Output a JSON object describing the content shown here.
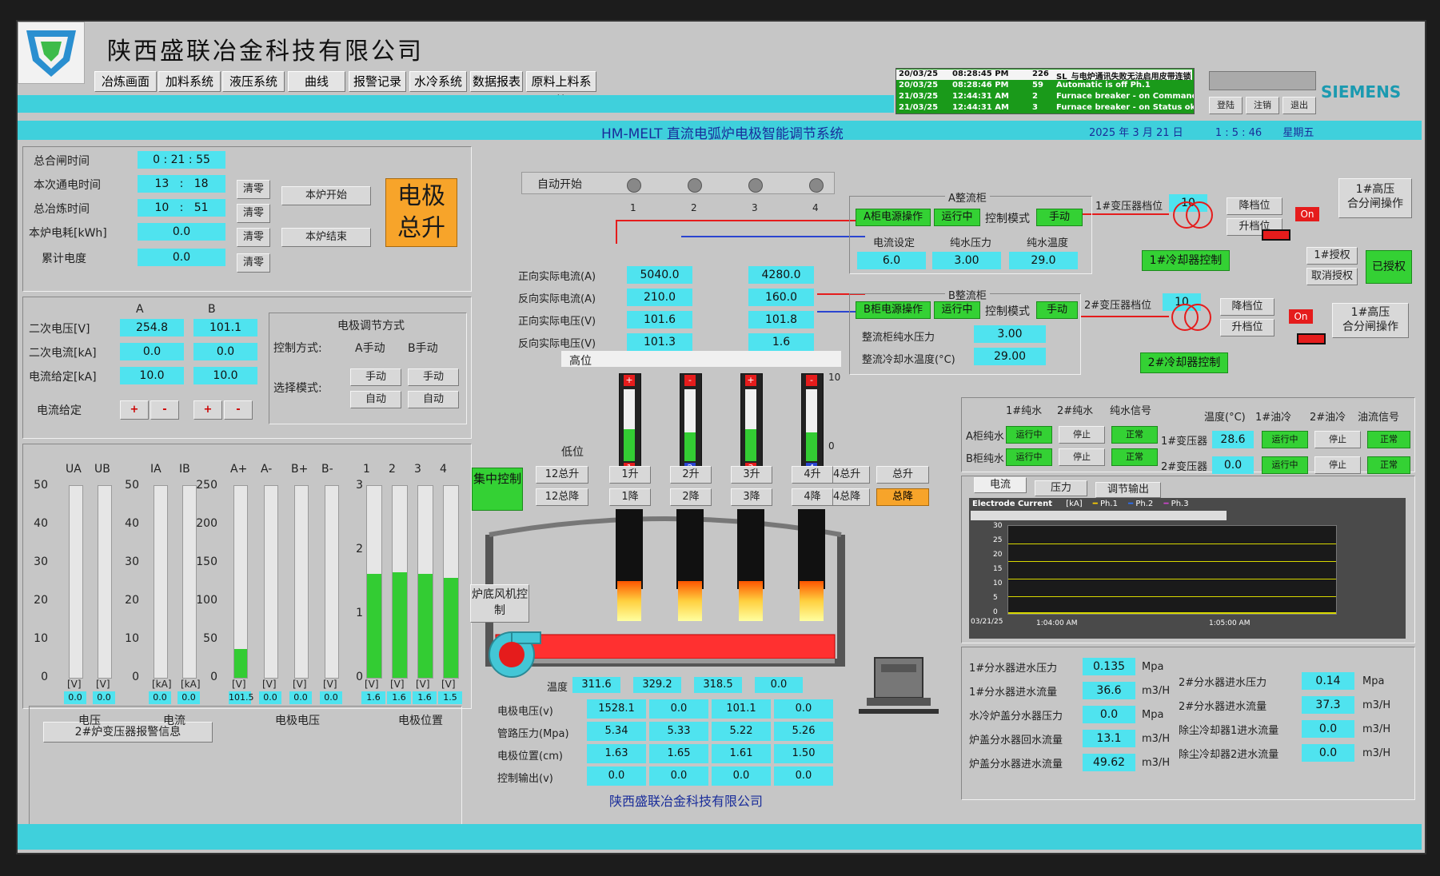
{
  "company": {
    "title": "陕西盛联冶金科技有限公司",
    "footer": "陕西盛联冶金科技有限公司"
  },
  "nav": [
    "冶炼画面",
    "加料系统",
    "液压系统",
    "曲线",
    "报警记录",
    "水冷系统",
    "数据报表",
    "原料上料系统"
  ],
  "system_title": "HM-MELT 直流电弧炉电极智能调节系统",
  "date": {
    "year": "2025",
    "year_unit": "年",
    "month": "3",
    "month_unit": "月",
    "day": "21",
    "day_unit": "日",
    "time": "1 : 5 : 46",
    "weekday": "星期五"
  },
  "brand": "SIEMENS",
  "login_buttons": [
    "登陆",
    "注销",
    "退出"
  ],
  "alarms": [
    {
      "date": "20/03/25",
      "time": "08:28:45 PM",
      "code": "226",
      "msg": "SL_与电炉通讯失败无法启用皮带连锁",
      "color": "#222"
    },
    {
      "date": "20/03/25",
      "time": "08:28:46 PM",
      "code": "59",
      "msg": "Automatic is off Ph.1",
      "color": "#1a9a1a"
    },
    {
      "date": "21/03/25",
      "time": "12:44:31 AM",
      "code": "2",
      "msg": "Furnace breaker - on Command",
      "color": "#1a9a1a"
    },
    {
      "date": "21/03/25",
      "time": "12:44:31 AM",
      "code": "3",
      "msg": "Furnace breaker - on Status ok",
      "color": "#1a9a1a"
    }
  ],
  "timers": {
    "total_close_label": "总合闸时间",
    "total_close_value": "0 : 21 : 55",
    "power_on_label": "本次通电时间",
    "power_on_h": "13",
    "power_on_sep": ":",
    "power_on_m": "18",
    "smelt_label": "总冶炼时间",
    "smelt_h": "10",
    "smelt_sep": ":",
    "smelt_m": "51",
    "energy_label": "本炉电耗[kWh]",
    "energy_value": "0.0",
    "cumulative_label": "累计电度",
    "cumulative_value": "0.0",
    "clear_label": "清零",
    "start_label": "本炉开始",
    "end_label": "本炉结束",
    "raise_all": "电极总升"
  },
  "ab_params": {
    "col_a": "A",
    "col_b": "B",
    "rows": [
      {
        "label": "二次电压[V]",
        "a": "254.8",
        "b": "101.1"
      },
      {
        "label": "二次电流[kA]",
        "a": "0.0",
        "b": "0.0"
      },
      {
        "label": "电流给定[kA]",
        "a": "10.0",
        "b": "10.0"
      }
    ],
    "setpoint_label": "电流给定",
    "plus": "+",
    "minus": "-"
  },
  "regulation": {
    "title": "电极调节方式",
    "control_label": "控制方式:",
    "a_manual": "A手动",
    "b_manual": "B手动",
    "select_label": "选择模式:",
    "manual": "手动",
    "auto": "自动"
  },
  "bars": {
    "volt": {
      "cols": [
        "UA",
        "UB"
      ],
      "ticks": [
        "50",
        "40",
        "30",
        "20",
        "10",
        "0"
      ],
      "values": [
        "0.0",
        "0.0"
      ],
      "fill": [
        0,
        0
      ],
      "unit": "[V]",
      "caption": "电压"
    },
    "curr": {
      "cols": [
        "IA",
        "IB"
      ],
      "ticks": [
        "50",
        "40",
        "30",
        "20",
        "10",
        "0"
      ],
      "values": [
        "0.0",
        "0.0"
      ],
      "fill": [
        0,
        0
      ],
      "unit": "[kA]",
      "caption": "电流"
    },
    "evolt": {
      "cols": [
        "A+",
        "A-",
        "B+",
        "B-"
      ],
      "ticks": [
        "250",
        "200",
        "150",
        "100",
        "50",
        "0"
      ],
      "values": [
        "101.5",
        "0.0",
        "0.0",
        "0.0"
      ],
      "fill": [
        0.15,
        0,
        0,
        0
      ],
      "unit": "[V]",
      "caption": "电极电压"
    },
    "epos": {
      "cols": [
        "1",
        "2",
        "3",
        "4"
      ],
      "ticks": [
        "3",
        "2",
        "1",
        "0"
      ],
      "values": [
        "1.6",
        "1.6",
        "1.6",
        "1.5"
      ],
      "fill": [
        0.54,
        0.55,
        0.54,
        0.52
      ],
      "unit": "[V]",
      "caption": "电极位置"
    }
  },
  "alarm_info_label": "2#炉变压器报警信息",
  "auto_start": {
    "label": "自动开始",
    "numbers": [
      "1",
      "2",
      "3",
      "4"
    ]
  },
  "currents": {
    "labels": [
      "正向实际电流(A)",
      "反向实际电流(A)",
      "正向实际电压(V)",
      "反向实际电压(V)"
    ],
    "col1": [
      "5040.0",
      "210.0",
      "101.6",
      "101.3"
    ],
    "col2": [
      "4280.0",
      "160.0",
      "101.8",
      "1.6"
    ]
  },
  "electrodes": {
    "high_label": "高位",
    "low_label": "低位",
    "scale_top": "10",
    "scale_bottom": "0",
    "labels_top": [
      "+",
      "-",
      "+",
      "-"
    ],
    "labels_bottom": [
      "1",
      "2",
      "3",
      "4"
    ],
    "levels": [
      0.45,
      0.4,
      0.45,
      0.4
    ],
    "central_control": "集中控制",
    "up": [
      "1升",
      "2升",
      "3升",
      "4升"
    ],
    "down": [
      "1降",
      "2降",
      "3降",
      "4降"
    ],
    "group_up_12": "12总升",
    "group_down_12": "12总降",
    "group_up_34": "34总升",
    "group_down_34": "34总降",
    "total_up": "总升",
    "total_down": "总降"
  },
  "fan_label": "炉底风机控制",
  "temperature": {
    "label": "温度",
    "values": [
      "311.6",
      "329.2",
      "318.5",
      "0.0"
    ]
  },
  "bottom_table": {
    "labels": [
      "电极电压(v)",
      "管路压力(Mpa)",
      "电极位置(cm)",
      "控制输出(v)"
    ],
    "rows": [
      [
        "1528.1",
        "0.0",
        "101.1",
        "0.0"
      ],
      [
        "5.34",
        "5.33",
        "5.22",
        "5.26"
      ],
      [
        "1.63",
        "1.65",
        "1.61",
        "1.50"
      ],
      [
        "0.0",
        "0.0",
        "0.0",
        "0.0"
      ]
    ]
  },
  "rect_a": {
    "title": "A整流柜",
    "power_op": "A柜电源操作",
    "running": "运行中",
    "mode_label": "控制模式",
    "mode": "手动",
    "headers": [
      "电流设定",
      "纯水压力",
      "纯水温度"
    ],
    "values": [
      "6.0",
      "3.00",
      "29.0"
    ]
  },
  "rect_b": {
    "title": "B整流柜",
    "power_op": "B柜电源操作",
    "running": "运行中",
    "mode_label": "控制模式",
    "mode": "手动",
    "rows": [
      {
        "label": "整流柜纯水压力",
        "value": "3.00"
      },
      {
        "label": "整流冷却水温度(°C)",
        "value": "29.00"
      }
    ]
  },
  "transformer": {
    "t1_label": "1#变压器档位",
    "t1_value": "10",
    "t2_label": "2#变压器档位",
    "t2_value": "10",
    "down": "降档位",
    "up": "升档位",
    "on": "On",
    "hv1": "1#高压\n合分闸操作",
    "hv2": "1#高压\n合分闸操作",
    "cool1": "1#冷却器控制",
    "cool2": "2#冷却器控制",
    "auth": "1#授权",
    "revoke": "取消授权",
    "authorized": "已授权"
  },
  "water": {
    "h1": "1#纯水",
    "h2": "2#纯水",
    "h3": "纯水信号",
    "rows": [
      {
        "label": "A柜纯水",
        "s1": "运行中",
        "s2": "停止",
        "s3": "正常"
      },
      {
        "label": "B柜纯水",
        "s1": "运行中",
        "s2": "停止",
        "s3": "正常"
      }
    ],
    "temp_h": "温度(°C)",
    "oil1_h": "1#油冷",
    "oil2_h": "2#油冷",
    "flow_h": "油流信号",
    "trows": [
      {
        "label": "1#变压器",
        "t": "28.6",
        "o1": "运行中",
        "o2": "停止",
        "f": "正常"
      },
      {
        "label": "2#变压器",
        "t": "0.0",
        "o1": "运行中",
        "o2": "停止",
        "f": "正常"
      }
    ]
  },
  "trend": {
    "tabs": [
      "电流",
      "压力",
      "调节输出"
    ],
    "title": "Electrode Current",
    "unit": "[kA]",
    "legend": [
      "Ph.1",
      "Ph.2",
      "Ph.3"
    ],
    "yticks": [
      "30",
      "25",
      "20",
      "15",
      "10",
      "5",
      "0"
    ],
    "date": "03/21/25",
    "t1": "1:04:00 AM",
    "t2": "1:05:00 AM"
  },
  "distributors": {
    "left": [
      {
        "label": "1#分水器进水压力",
        "value": "0.135",
        "unit": "Mpa"
      },
      {
        "label": "1#分水器进水流量",
        "value": "36.6",
        "unit": "m3/H"
      },
      {
        "label": "水冷炉盖分水器压力",
        "value": "0.0",
        "unit": "Mpa"
      },
      {
        "label": "炉盖分水器回水流量",
        "value": "13.1",
        "unit": "m3/H"
      },
      {
        "label": "炉盖分水器进水流量",
        "value": "49.62",
        "unit": "m3/H"
      }
    ],
    "right": [
      {
        "label": "2#分水器进水压力",
        "value": "0.14",
        "unit": "Mpa"
      },
      {
        "label": "2#分水器进水流量",
        "value": "37.3",
        "unit": "m3/H"
      },
      {
        "label": "除尘冷却器1进水流量",
        "value": "0.0",
        "unit": "m3/H"
      },
      {
        "label": "除尘冷却器2进水流量",
        "value": "0.0",
        "unit": "m3/H"
      }
    ]
  },
  "colors": {
    "cyan": "#4fe3ef",
    "green": "#34d134",
    "red": "#e51c1c",
    "orange": "#f7a42a"
  }
}
